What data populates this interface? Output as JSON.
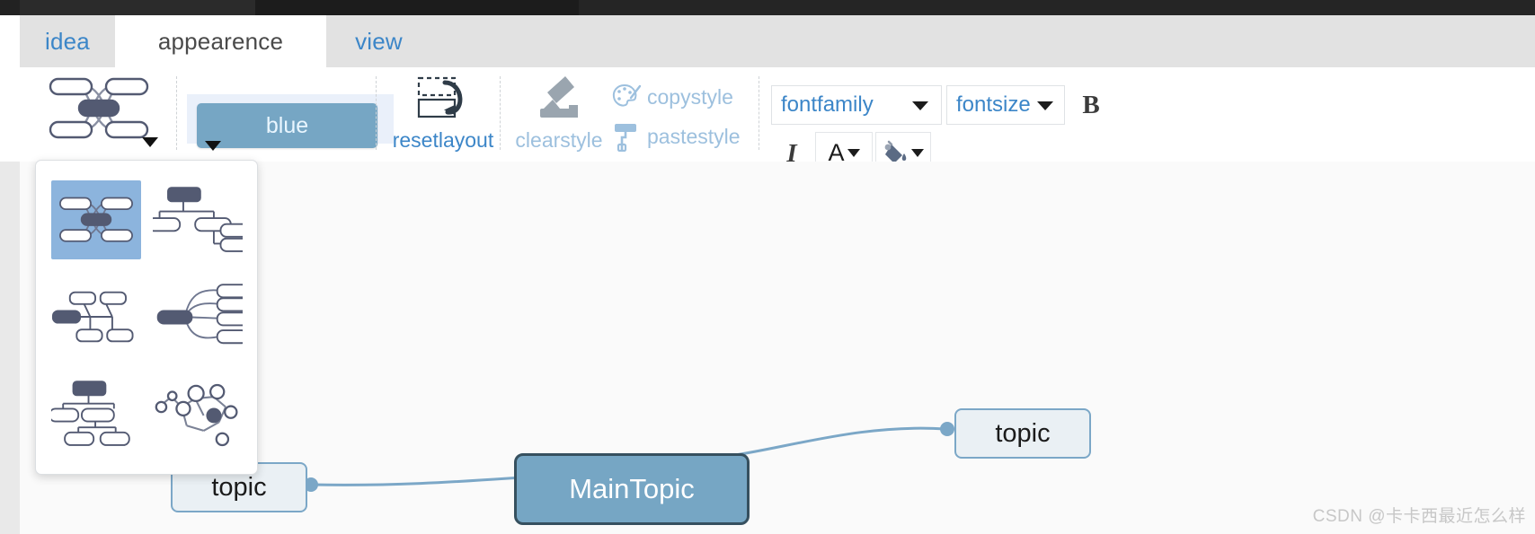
{
  "window": {
    "title_bar_visible": true
  },
  "tabs": [
    {
      "label": "idea",
      "active": false
    },
    {
      "label": "appearence",
      "active": true
    },
    {
      "label": "view",
      "active": false
    }
  ],
  "toolbar": {
    "layout_button": {
      "icon": "mindmap-balanced-icon",
      "has_dropdown": true
    },
    "theme_button": {
      "label": "blue",
      "has_dropdown": true
    },
    "reset_layout": {
      "label": "resetlayout",
      "icon": "reset-layout-icon"
    },
    "clear_style": {
      "label": "clearstyle",
      "icon": "brush-icon"
    },
    "copy_style": {
      "label": "copystyle",
      "icon": "palette-icon"
    },
    "paste_style": {
      "label": "pastestyle",
      "icon": "paint-roller-icon"
    },
    "font_family": {
      "value": "fontfamily",
      "has_dropdown": true
    },
    "font_size": {
      "value": "fontsize",
      "has_dropdown": true
    },
    "bold": {
      "label": "B"
    },
    "italic": {
      "label": "I"
    },
    "font_color": {
      "glyph": "A",
      "has_dropdown": true
    },
    "fill_color": {
      "icon": "paint-bucket-icon",
      "has_dropdown": true,
      "swatch_color": "#76a6c4"
    }
  },
  "layout_dropdown": {
    "open": true,
    "options": [
      {
        "name": "balanced-map",
        "selected": true
      },
      {
        "name": "org-chart-down",
        "selected": false
      },
      {
        "name": "tree-right",
        "selected": false
      },
      {
        "name": "fishbone-right",
        "selected": false
      },
      {
        "name": "org-chart-tree",
        "selected": false
      },
      {
        "name": "bubble-network",
        "selected": false
      }
    ]
  },
  "canvas": {
    "nodes": [
      {
        "id": "topic-right",
        "label": "topic",
        "type": "child"
      },
      {
        "id": "main-topic",
        "label": "MainTopic",
        "type": "root"
      },
      {
        "id": "topic-left",
        "label": "topic",
        "type": "child"
      }
    ]
  },
  "watermark": {
    "text": "CSDN @卡卡西最近怎么样"
  },
  "colors": {
    "accent_blue": "#3c86c8",
    "node_fill": "#76a6c4",
    "node_border": "#36505f",
    "child_fill": "#eaf0f4",
    "child_border": "#7ba7c7",
    "selected_swatch": "#8cb4dd",
    "tab_inactive_bg": "#e2e2e2"
  }
}
